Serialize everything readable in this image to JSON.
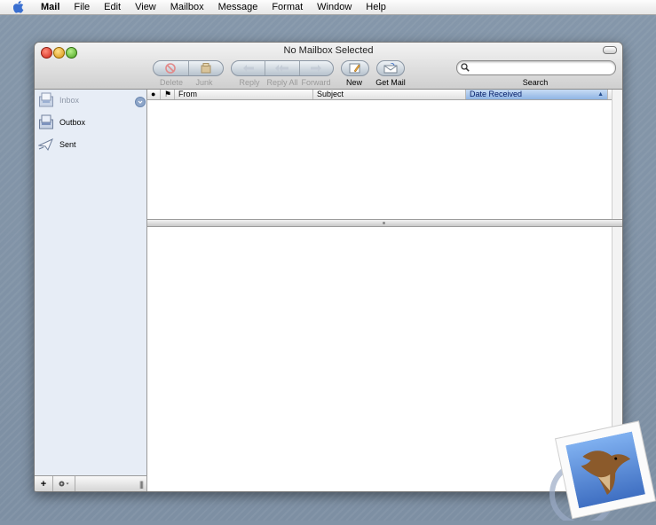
{
  "menubar": {
    "app_name": "Mail",
    "items": [
      "File",
      "Edit",
      "View",
      "Mailbox",
      "Message",
      "Format",
      "Window",
      "Help"
    ]
  },
  "window": {
    "title": "No Mailbox Selected"
  },
  "toolbar": {
    "delete_label": "Delete",
    "junk_label": "Junk",
    "reply_label": "Reply",
    "reply_all_label": "Reply All",
    "forward_label": "Forward",
    "new_label": "New",
    "get_mail_label": "Get Mail",
    "search_label": "Search",
    "search_value": ""
  },
  "sidebar": {
    "mailboxes": [
      {
        "label": "Inbox",
        "icon": "inbox-icon",
        "state": "dim"
      },
      {
        "label": "Outbox",
        "icon": "outbox-icon",
        "state": "normal"
      },
      {
        "label": "Sent",
        "icon": "sent-icon",
        "state": "normal"
      }
    ],
    "add_label": "+"
  },
  "message_list": {
    "columns": [
      {
        "key": "read",
        "label": "●"
      },
      {
        "key": "flag",
        "label": "⚑"
      },
      {
        "key": "from",
        "label": "From"
      },
      {
        "key": "subject",
        "label": "Subject"
      },
      {
        "key": "date",
        "label": "Date Received",
        "sorted": true
      }
    ],
    "rows": []
  },
  "colors": {
    "accent": "#3875d7",
    "sidebar_bg": "#e7edf6",
    "sorted_header": "#8fb4e4"
  }
}
